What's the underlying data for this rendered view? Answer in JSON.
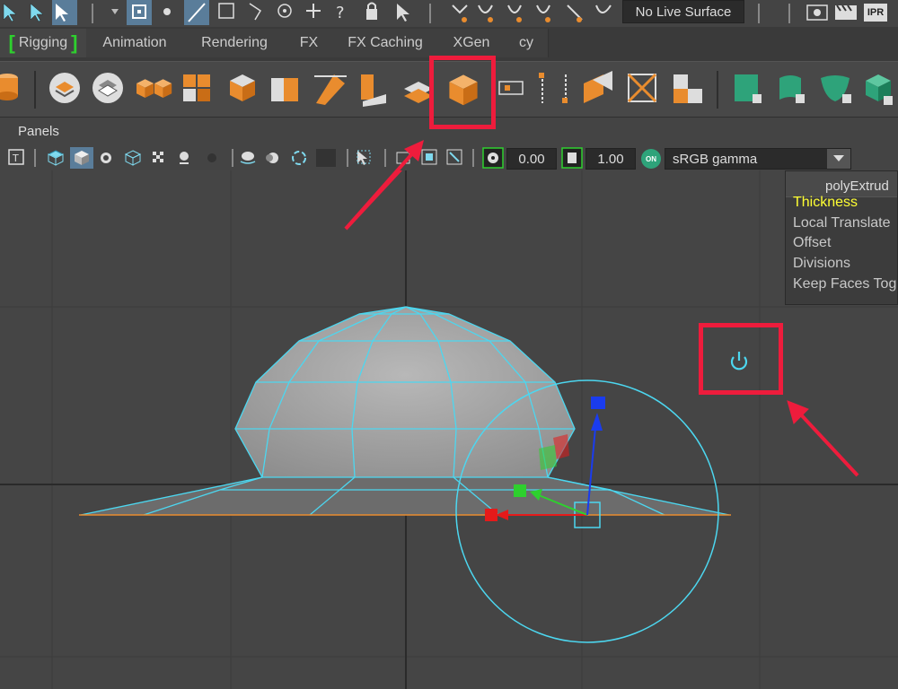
{
  "top_toolbar": {
    "live_surface_label": "No Live Surface",
    "ipr_label": "IPR"
  },
  "shelf_tabs": [
    {
      "label": "Rigging",
      "active": true
    },
    {
      "label": "Animation"
    },
    {
      "label": "Rendering"
    },
    {
      "label": "FX"
    },
    {
      "label": "FX Caching"
    },
    {
      "label": "XGen"
    },
    {
      "label": "cy"
    }
  ],
  "panels_menu": {
    "label": "Panels"
  },
  "panel_toolbar": {
    "exposure_value": "0.00",
    "gamma_value": "1.00",
    "on_badge": "ON",
    "colorspace_value": "sRGB gamma"
  },
  "channel_box": {
    "node_name": "polyExtrud",
    "attributes": [
      {
        "label": "Thickness",
        "highlighted": true
      },
      {
        "label": "Local Translate"
      },
      {
        "label": "Offset"
      },
      {
        "label": "Divisions"
      },
      {
        "label": "Keep Faces Tog"
      }
    ]
  },
  "colors": {
    "accent_highlight": "#ee1c3c",
    "selection_cyan": "#4cd7f0",
    "shelf_orange": "#e98c2e",
    "shelf_green": "#2ea37a",
    "tab_bracket_green": "#2ed02e",
    "channel_highlight_yellow": "#ffff33"
  }
}
